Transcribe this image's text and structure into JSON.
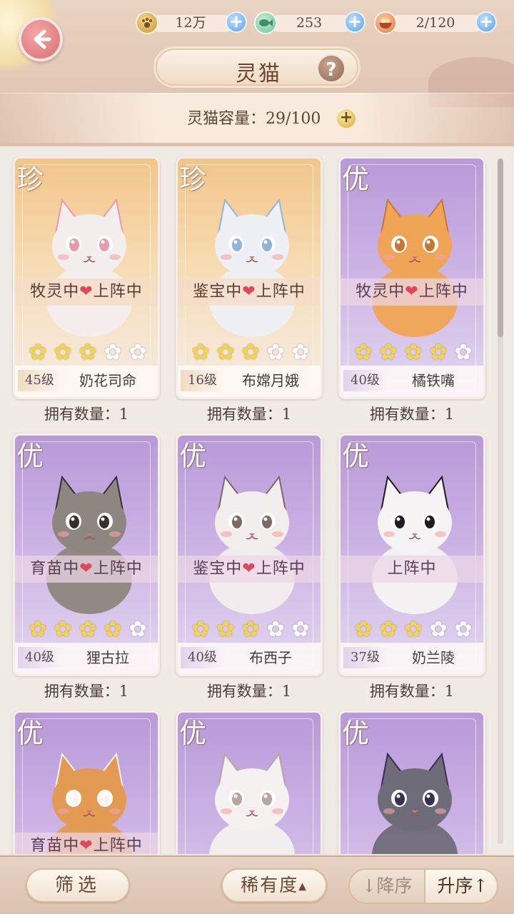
{
  "header": {
    "title": "灵猫",
    "help_symbol": "?",
    "capacity_label": "灵猫容量：29/100",
    "resources": [
      {
        "icon": "paw-coin-icon",
        "value": "12万"
      },
      {
        "icon": "fish-token-icon",
        "value": "253"
      },
      {
        "icon": "food-bowl-icon",
        "value": "2/120"
      }
    ]
  },
  "cards": [
    {
      "rank": "珍",
      "status_left": "牧灵中",
      "status_right": "上阵中",
      "stars": 3,
      "level": "45级",
      "name": "奶花司命",
      "count": "拥有数量：1",
      "rarity_class": "zhen",
      "fur": "#f4eeee",
      "accent": "#e79aa8"
    },
    {
      "rank": "珍",
      "status_left": "鉴宝中",
      "status_right": "上阵中",
      "stars": 3,
      "level": "16级",
      "name": "布嫦月娥",
      "count": "拥有数量：1",
      "rarity_class": "zhen",
      "fur": "#eef0f5",
      "accent": "#8fb6d8"
    },
    {
      "rank": "优",
      "status_left": "牧灵中",
      "status_right": "上阵中",
      "stars": 4,
      "level": "40级",
      "name": "橘铁嘴",
      "count": "拥有数量：1",
      "rarity_class": "you",
      "fur": "#f0a455",
      "accent": "#c7772f"
    },
    {
      "rank": "优",
      "status_left": "育苗中",
      "status_right": "上阵中",
      "stars": 4,
      "level": "40级",
      "name": "狸古拉",
      "count": "拥有数量：1",
      "rarity_class": "you",
      "fur": "#8e8680",
      "accent": "#3a2f2f"
    },
    {
      "rank": "优",
      "status_left": "鉴宝中",
      "status_right": "上阵中",
      "stars": 3,
      "level": "40级",
      "name": "布西子",
      "count": "拥有数量：1",
      "rarity_class": "you",
      "fur": "#f3eeee",
      "accent": "#7b6a66"
    },
    {
      "rank": "优",
      "status_left": "",
      "status_right": "上阵中",
      "stars": 3,
      "level": "37级",
      "name": "奶兰陵",
      "count": "拥有数量：1",
      "rarity_class": "you",
      "fur": "#f5f3f3",
      "accent": "#1f1b22"
    },
    {
      "rank": "优",
      "status_left": "育苗中",
      "status_right": "上阵中",
      "stars": 0,
      "level": "",
      "name": "",
      "count": "",
      "rarity_class": "you",
      "fur": "#e39a52",
      "accent": "#fbf4ef"
    },
    {
      "rank": "优",
      "status_left": "",
      "status_right": "",
      "stars": 0,
      "level": "",
      "name": "",
      "count": "",
      "rarity_class": "you",
      "fur": "#f4f1f0",
      "accent": "#b8a6a2"
    },
    {
      "rank": "优",
      "status_left": "",
      "status_right": "",
      "stars": 0,
      "level": "",
      "name": "",
      "count": "",
      "rarity_class": "you",
      "fur": "#6f6c79",
      "accent": "#3b2f55"
    }
  ],
  "heart_symbol": "❤",
  "star_glyph": "✿",
  "footer": {
    "filter_label": "筛选",
    "rarity_label": "稀有度",
    "rarity_caret": "▲",
    "sort_desc_label": "↓降序",
    "sort_asc_label": "升序↑"
  }
}
